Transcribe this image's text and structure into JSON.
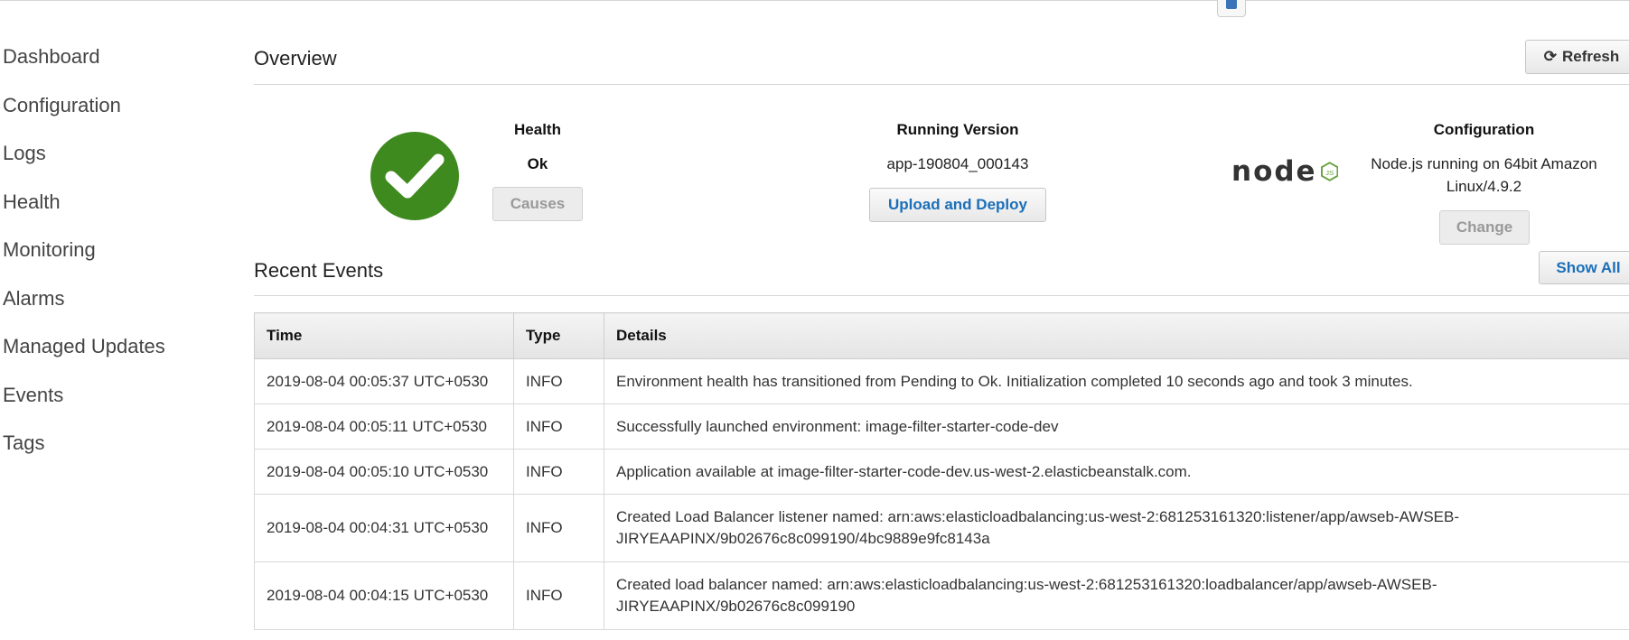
{
  "sidebar": {
    "items": [
      {
        "label": "Dashboard"
      },
      {
        "label": "Configuration"
      },
      {
        "label": "Logs"
      },
      {
        "label": "Health"
      },
      {
        "label": "Monitoring"
      },
      {
        "label": "Alarms"
      },
      {
        "label": "Managed Updates"
      },
      {
        "label": "Events"
      },
      {
        "label": "Tags"
      }
    ]
  },
  "overview": {
    "title": "Overview",
    "refresh_label": "Refresh",
    "health": {
      "heading": "Health",
      "status": "Ok",
      "causes_label": "Causes",
      "status_color": "#3f8a1f"
    },
    "running_version": {
      "heading": "Running Version",
      "value": "app-190804_000143",
      "upload_label": "Upload and Deploy"
    },
    "configuration": {
      "heading": "Configuration",
      "platform_line1": "Node.js running on 64bit Amazon",
      "platform_line2": "Linux/4.9.2",
      "change_label": "Change",
      "logo_text": "node"
    }
  },
  "recent_events": {
    "title": "Recent Events",
    "show_all_label": "Show All",
    "columns": [
      "Time",
      "Type",
      "Details"
    ],
    "rows": [
      {
        "time": "2019-08-04 00:05:37 UTC+0530",
        "type": "INFO",
        "details": "Environment health has transitioned from Pending to Ok. Initialization completed 10 seconds ago and took 3 minutes."
      },
      {
        "time": "2019-08-04 00:05:11 UTC+0530",
        "type": "INFO",
        "details": "Successfully launched environment: image-filter-starter-code-dev"
      },
      {
        "time": "2019-08-04 00:05:10 UTC+0530",
        "type": "INFO",
        "details": "Application available at image-filter-starter-code-dev.us-west-2.elasticbeanstalk.com."
      },
      {
        "time": "2019-08-04 00:04:31 UTC+0530",
        "type": "INFO",
        "details": "Created Load Balancer listener named: arn:aws:elasticloadbalancing:us-west-2:681253161320:listener/app/awseb-AWSEB-JIRYEAAPINX/9b02676c8c099190/4bc9889e9fc8143a"
      },
      {
        "time": "2019-08-04 00:04:15 UTC+0530",
        "type": "INFO",
        "details": "Created load balancer named: arn:aws:elasticloadbalancing:us-west-2:681253161320:loadbalancer/app/awseb-AWSEB-JIRYEAAPINX/9b02676c8c099190"
      }
    ]
  },
  "colors": {
    "info": "#4b8a1a",
    "link": "#1b6fb8"
  }
}
